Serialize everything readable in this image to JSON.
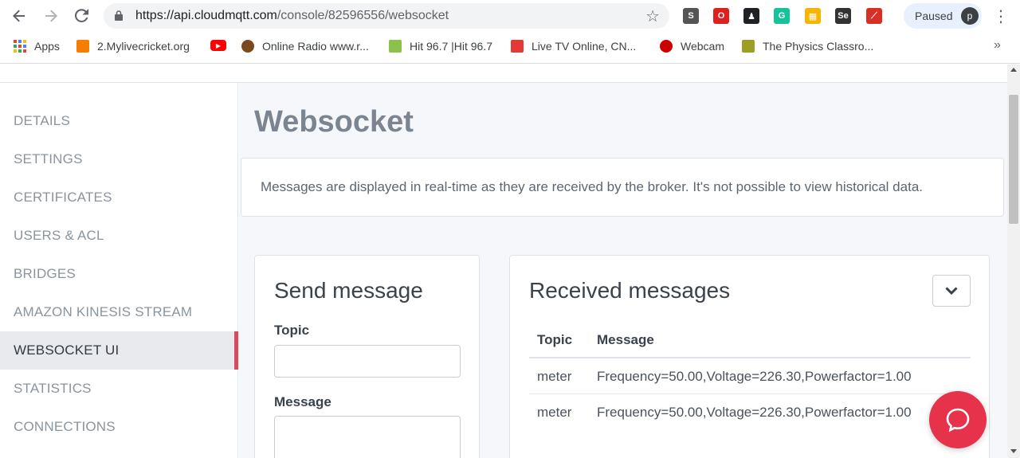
{
  "browser": {
    "url_host": "https://api.cloudmqtt.com",
    "url_path": "/console/82596556/websocket",
    "profile_label": "Paused",
    "avatar_letter": "p",
    "extensions": [
      {
        "name": "s-extension-icon",
        "glyph": "S",
        "color": "#555555"
      },
      {
        "name": "opera-extension-icon",
        "glyph": "O",
        "color": "#e0201e"
      },
      {
        "name": "figure-extension-icon",
        "glyph": "♟",
        "color": "#202124"
      },
      {
        "name": "grammarly-extension-icon",
        "glyph": "G",
        "color": "#15c39a"
      },
      {
        "name": "calendar-extension-icon",
        "glyph": "▦",
        "color": "#f4b400"
      },
      {
        "name": "selenium-extension-icon",
        "glyph": "Se",
        "color": "#333333"
      },
      {
        "name": "pdf-extension-icon",
        "glyph": "⟋",
        "color": "#d93025"
      }
    ]
  },
  "bookmarks": [
    {
      "label": "Apps",
      "icon": "apps-grid-icon",
      "color": "#ea4335"
    },
    {
      "label": "2.Mylivecricket.org",
      "icon": "blogger-icon",
      "color": "#f57d00"
    },
    {
      "label": "",
      "icon": "youtube-icon",
      "color": "#ff0000"
    },
    {
      "label": "Online Radio www.r...",
      "icon": "radio-icon",
      "color": "#7a4a1e"
    },
    {
      "label": "Hit 96.7 |Hit 96.7",
      "icon": "hit-icon",
      "color": "#8bc34a"
    },
    {
      "label": "Live TV Online, CN...",
      "icon": "live-tv-icon",
      "color": "#e53935"
    },
    {
      "label": "Webcam",
      "icon": "webcam-icon",
      "color": "#cc0000"
    },
    {
      "label": "The Physics Classro...",
      "icon": "physics-icon",
      "color": "#9e9d24"
    }
  ],
  "sidebar": {
    "items": [
      {
        "label": "DETAILS",
        "active": false
      },
      {
        "label": "SETTINGS",
        "active": false
      },
      {
        "label": "CERTIFICATES",
        "active": false
      },
      {
        "label": "USERS & ACL",
        "active": false
      },
      {
        "label": "BRIDGES",
        "active": false
      },
      {
        "label": "AMAZON KINESIS STREAM",
        "active": false
      },
      {
        "label": "WEBSOCKET UI",
        "active": true
      },
      {
        "label": "STATISTICS",
        "active": false
      },
      {
        "label": "CONNECTIONS",
        "active": false
      }
    ]
  },
  "main": {
    "title": "Websocket",
    "info": "Messages are displayed in real-time as they are received by the broker. It's not possible to view historical data."
  },
  "send_panel": {
    "title": "Send message",
    "topic_label": "Topic",
    "topic_value": "",
    "message_label": "Message",
    "message_value": ""
  },
  "received_panel": {
    "title": "Received messages",
    "columns": [
      "Topic",
      "Message"
    ],
    "rows": [
      {
        "topic": "meter",
        "message": "Frequency=50.00,Voltage=226.30,Powerfactor=1.00"
      },
      {
        "topic": "meter",
        "message": "Frequency=50.00,Voltage=226.30,Powerfactor=1.00"
      }
    ]
  },
  "colors": {
    "accent": "#e6324b",
    "active_indicator": "#d9485f"
  }
}
